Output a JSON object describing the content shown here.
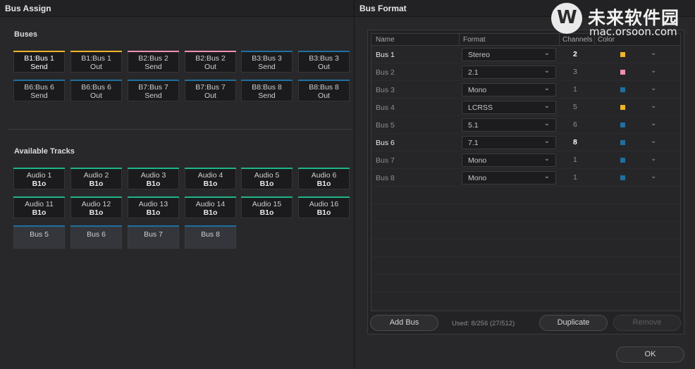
{
  "left_panel": {
    "title": "Bus Assign",
    "buses_label": "Buses",
    "tracks_label": "Available Tracks",
    "buses": [
      {
        "l1": "B1:Bus 1",
        "l2": "Send",
        "color": "#f0b429",
        "selected": true
      },
      {
        "l1": "B1:Bus 1",
        "l2": "Out",
        "color": "#f0b429",
        "selected": false
      },
      {
        "l1": "B2:Bus 2",
        "l2": "Send",
        "color": "#f18fb4",
        "selected": false
      },
      {
        "l1": "B2:Bus 2",
        "l2": "Out",
        "color": "#f18fb4",
        "selected": false
      },
      {
        "l1": "B3:Bus 3",
        "l2": "Send",
        "color": "#1f6f9f",
        "selected": false
      },
      {
        "l1": "B3:Bus 3",
        "l2": "Out",
        "color": "#1f6f9f",
        "selected": false
      },
      {
        "l1": "B6:Bus 6",
        "l2": "Send",
        "color": "#1f6f9f",
        "selected": false
      },
      {
        "l1": "B6:Bus 6",
        "l2": "Out",
        "color": "#1f6f9f",
        "selected": false
      },
      {
        "l1": "B7:Bus 7",
        "l2": "Send",
        "color": "#1f6f9f",
        "selected": false
      },
      {
        "l1": "B7:Bus 7",
        "l2": "Out",
        "color": "#1f6f9f",
        "selected": false
      },
      {
        "l1": "B8:Bus 8",
        "l2": "Send",
        "color": "#1f6f9f",
        "selected": false
      },
      {
        "l1": "B8:Bus 8",
        "l2": "Out",
        "color": "#1f6f9f",
        "selected": false
      }
    ],
    "tracks": [
      {
        "l1": "Audio 1",
        "l2": "B1o"
      },
      {
        "l1": "Audio 2",
        "l2": "B1o"
      },
      {
        "l1": "Audio 3",
        "l2": "B1o"
      },
      {
        "l1": "Audio 4",
        "l2": "B1o"
      },
      {
        "l1": "Audio 5",
        "l2": "B1o"
      },
      {
        "l1": "Audio 6",
        "l2": "B1o"
      },
      {
        "l1": "Audio 11",
        "l2": "B1o"
      },
      {
        "l1": "Audio 12",
        "l2": "B1o"
      },
      {
        "l1": "Audio 13",
        "l2": "B1o"
      },
      {
        "l1": "Audio 14",
        "l2": "B1o"
      },
      {
        "l1": "Audio 15",
        "l2": "B1o"
      },
      {
        "l1": "Audio 16",
        "l2": "B1o"
      }
    ],
    "track_color": "#1fb58a",
    "bus_tracks": [
      "Bus 5",
      "Bus 6",
      "Bus 7",
      "Bus 8"
    ],
    "bus_track_color": "#1f6f9f"
  },
  "right_panel": {
    "title": "Bus Format",
    "columns": {
      "name": "Name",
      "format": "Format",
      "channels": "Channels",
      "color": "Color"
    },
    "rows": [
      {
        "name": "Bus 1",
        "format": "Stereo",
        "channels": "2",
        "color": "#f0b429",
        "active": true
      },
      {
        "name": "Bus 2",
        "format": "2.1",
        "channels": "3",
        "color": "#f18fb4",
        "active": false
      },
      {
        "name": "Bus 3",
        "format": "Mono",
        "channels": "1",
        "color": "#1f6f9f",
        "active": false
      },
      {
        "name": "Bus 4",
        "format": "LCRSS",
        "channels": "5",
        "color": "#f0b429",
        "active": false
      },
      {
        "name": "Bus 5",
        "format": "5.1",
        "channels": "6",
        "color": "#1f6f9f",
        "active": false
      },
      {
        "name": "Bus 6",
        "format": "7.1",
        "channels": "8",
        "color": "#1f6f9f",
        "active": true
      },
      {
        "name": "Bus 7",
        "format": "Mono",
        "channels": "1",
        "color": "#1f6f9f",
        "active": false
      },
      {
        "name": "Bus 8",
        "format": "Mono",
        "channels": "1",
        "color": "#1f6f9f",
        "active": false
      }
    ],
    "add_bus_label": "Add Bus",
    "used_text": "Used: 8/256  (27/512)",
    "duplicate_label": "Duplicate",
    "remove_label": "Remove",
    "ok_label": "OK"
  },
  "watermark": {
    "cn": "未来软件园",
    "en": "mac.orsoon.com"
  }
}
